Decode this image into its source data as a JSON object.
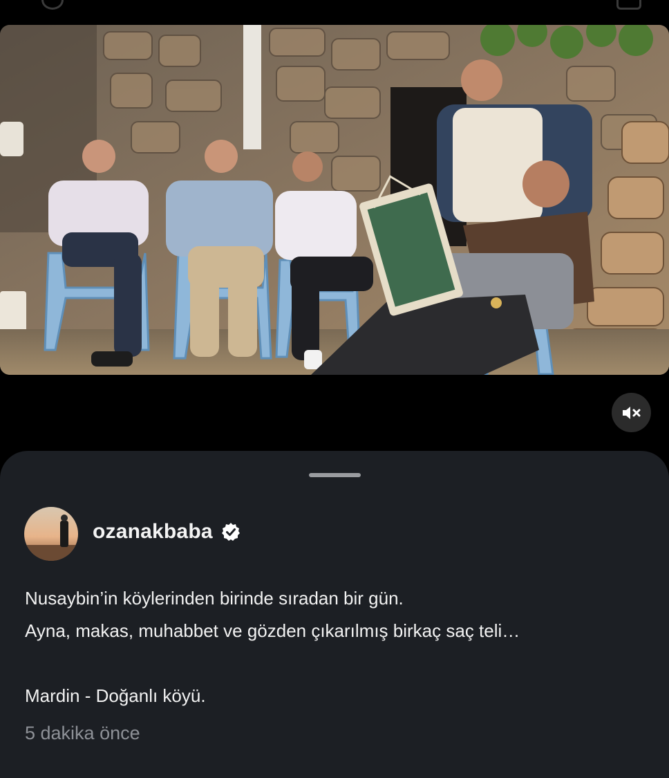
{
  "post": {
    "username": "ozanakbaba",
    "verified": true,
    "caption_lines": [
      "Nusaybin’in köylerinden birinde sıradan bir gün.",
      "Ayna, makas, muhabbet ve gözden çıkarılmış birkaç saç teli…",
      "Mardin - Doğanlı köyü."
    ],
    "timestamp": "5 dakika önce"
  },
  "media": {
    "icon": "mute-icon",
    "muted": true
  },
  "colors": {
    "sheet_background": "#1c1f24",
    "timestamp_text": "#8e9197",
    "verified_badge": "#ffffff"
  }
}
